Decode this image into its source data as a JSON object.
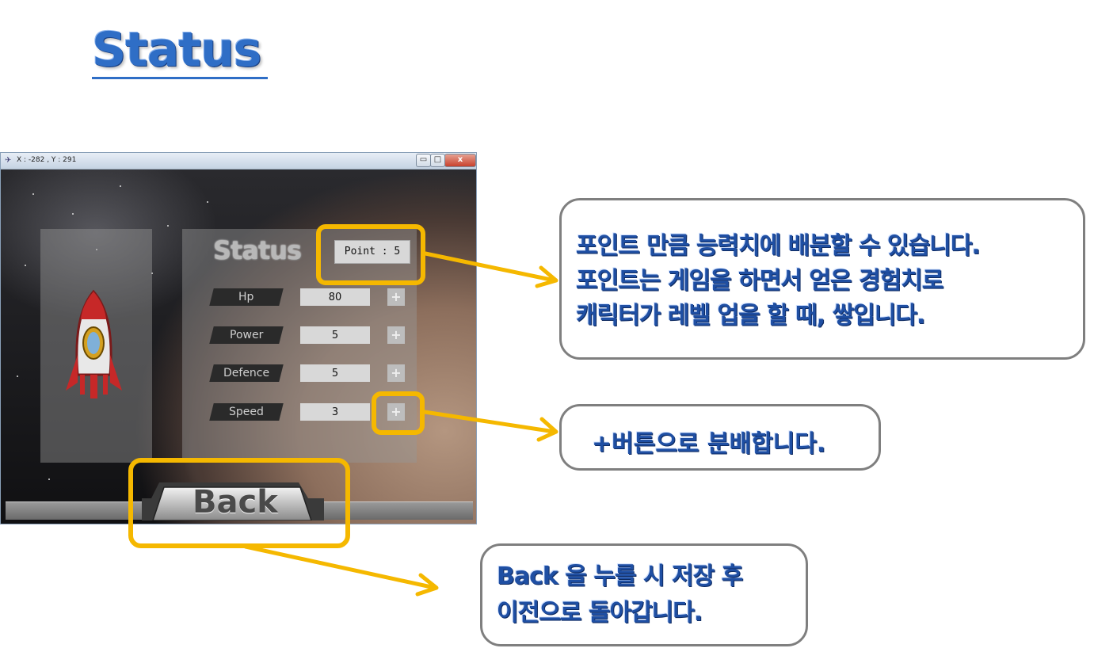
{
  "slide": {
    "title": "Status"
  },
  "window": {
    "title": "X : -282 , Y : 291",
    "min_button": "▭",
    "max_button": "□",
    "close_button": "x"
  },
  "game": {
    "status_logo": "Status",
    "point_label": "Point : 5",
    "stats": [
      {
        "label": "Hp",
        "value": "80",
        "plus": "+"
      },
      {
        "label": "Power",
        "value": "5",
        "plus": "+"
      },
      {
        "label": "Defence",
        "value": "5",
        "plus": "+"
      },
      {
        "label": "Speed",
        "value": "3",
        "plus": "+"
      }
    ],
    "back_label": "Back"
  },
  "callouts": {
    "point_desc": [
      "포인트 만큼 능력치에 배분할 수 있습니다.",
      "포인트는 게임을 하면서 얻은 경험치로",
      "캐릭터가 레벨 업을 할 때, 쌓입니다."
    ],
    "plus_desc": "+버튼으로 분배합니다.",
    "back_desc": [
      "Back 을 누를 시 저장 후",
      "이전으로 돌아갑니다."
    ]
  },
  "colors": {
    "highlight": "#f5b800",
    "callout_text": "#1f4fa3",
    "title": "#2f6ec6"
  }
}
